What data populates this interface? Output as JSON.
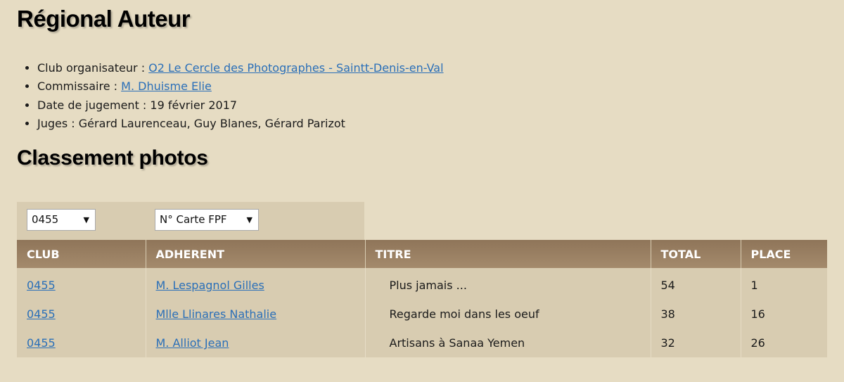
{
  "title": "Régional Auteur",
  "info": [
    {
      "label": "Club organisateur : ",
      "link": "O2 Le Cercle des Photographes - Saintt-Denis-en-Val",
      "text": ""
    },
    {
      "label": "Commissaire : ",
      "link": "M. Dhuisme Elie",
      "text": ""
    },
    {
      "label": "Date de jugement : ",
      "link": "",
      "text": "19 février 2017"
    },
    {
      "label": "Juges : ",
      "link": "",
      "text": "Gérard Laurenceau, Guy Blanes, Gérard Parizot"
    }
  ],
  "section_title": "Classement photos",
  "filters": {
    "club_value": "0455",
    "sort_value": "N° Carte FPF"
  },
  "table": {
    "headers": [
      "CLUB",
      "ADHERENT",
      "TITRE",
      "TOTAL",
      "PLACE"
    ],
    "rows": [
      [
        "0455",
        "M. Lespagnol Gilles",
        "Plus jamais ...",
        "54",
        "1"
      ],
      [
        "0455",
        "Mlle Llinares Nathalie",
        "Regarde moi dans les oeuf",
        "38",
        "16"
      ],
      [
        "0455",
        "M. Alliot Jean",
        "Artisans à Sanaa Yemen",
        "32",
        "26"
      ]
    ]
  },
  "colors": {
    "background": "#e6dcc3",
    "panel": "#d8ccb1",
    "header": "#8f7559",
    "link": "#2a6fb8"
  }
}
